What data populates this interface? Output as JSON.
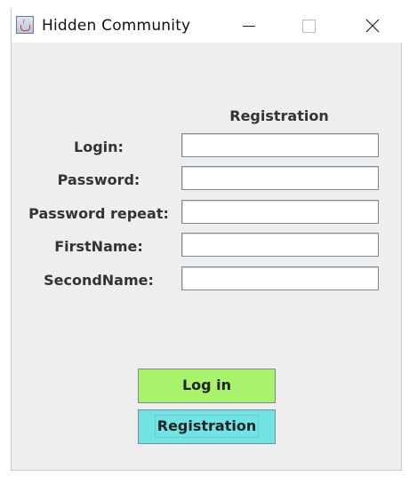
{
  "window": {
    "title": "Hidden Community",
    "icon": "java-cup-icon"
  },
  "form": {
    "header": "Registration",
    "fields": [
      {
        "label": "Login:",
        "value": "",
        "placeholder": ""
      },
      {
        "label": "Password:",
        "value": "",
        "placeholder": ""
      },
      {
        "label": "Password repeat:",
        "value": "",
        "placeholder": ""
      },
      {
        "label": "FirstName:",
        "value": "",
        "placeholder": ""
      },
      {
        "label": "SecondName:",
        "value": "",
        "placeholder": ""
      }
    ]
  },
  "buttons": {
    "login_label": "Log in",
    "login_color": "#a8f26c",
    "register_label": "Registration",
    "register_color": "#71e3e5"
  },
  "colors": {
    "window_bg": "#eeeeee",
    "titlebar_bg": "#ffffff"
  }
}
